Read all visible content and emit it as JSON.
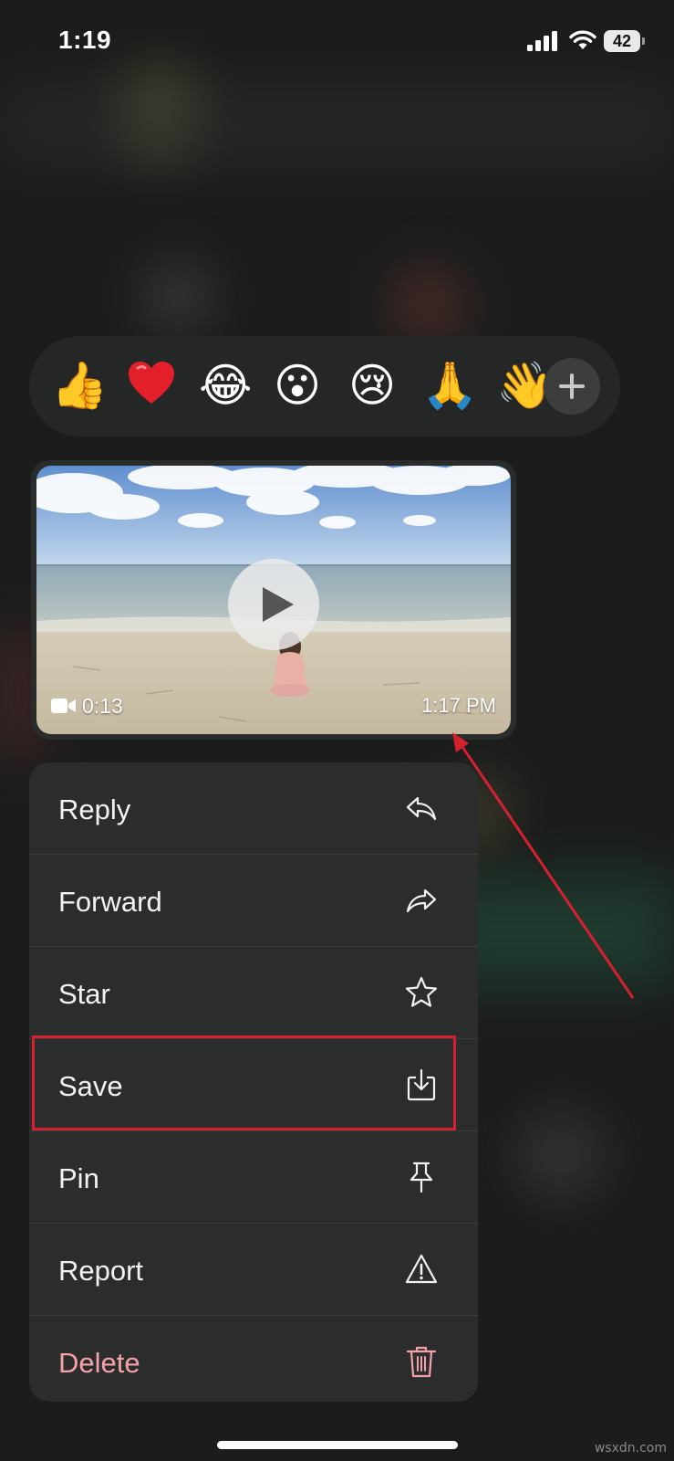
{
  "status_bar": {
    "time": "1:19",
    "battery_level": "42",
    "icons": [
      "signal-icon",
      "wifi-icon",
      "battery-icon"
    ]
  },
  "reactions": {
    "emojis": [
      {
        "name": "thumbs-up",
        "char": "👍"
      },
      {
        "name": "heart",
        "char": "❤️"
      },
      {
        "name": "tears-of-joy",
        "char": "😂"
      },
      {
        "name": "surprised",
        "char": "😮"
      },
      {
        "name": "crying",
        "char": "😢"
      },
      {
        "name": "folded-hands",
        "char": "🙏"
      },
      {
        "name": "waving-hand",
        "char": "👋"
      }
    ],
    "more_icon": "plus-icon"
  },
  "message": {
    "type": "video",
    "duration": "0:13",
    "timestamp": "1:17 PM",
    "icons": [
      "play-icon",
      "video-camera-icon"
    ]
  },
  "menu": {
    "items": [
      {
        "label": "Reply",
        "icon": "reply-icon"
      },
      {
        "label": "Forward",
        "icon": "forward-icon"
      },
      {
        "label": "Star",
        "icon": "star-icon"
      },
      {
        "label": "Save",
        "icon": "save-icon",
        "highlighted": true
      },
      {
        "label": "Pin",
        "icon": "pin-icon"
      },
      {
        "label": "Report",
        "icon": "report-icon"
      },
      {
        "label": "Delete",
        "icon": "trash-icon",
        "destructive": true
      }
    ]
  },
  "colors": {
    "annotation": "#d5212f",
    "destructive": "#f4a1aa",
    "menu_background": "#2b2c2c"
  },
  "watermark": "wsxdn.com"
}
